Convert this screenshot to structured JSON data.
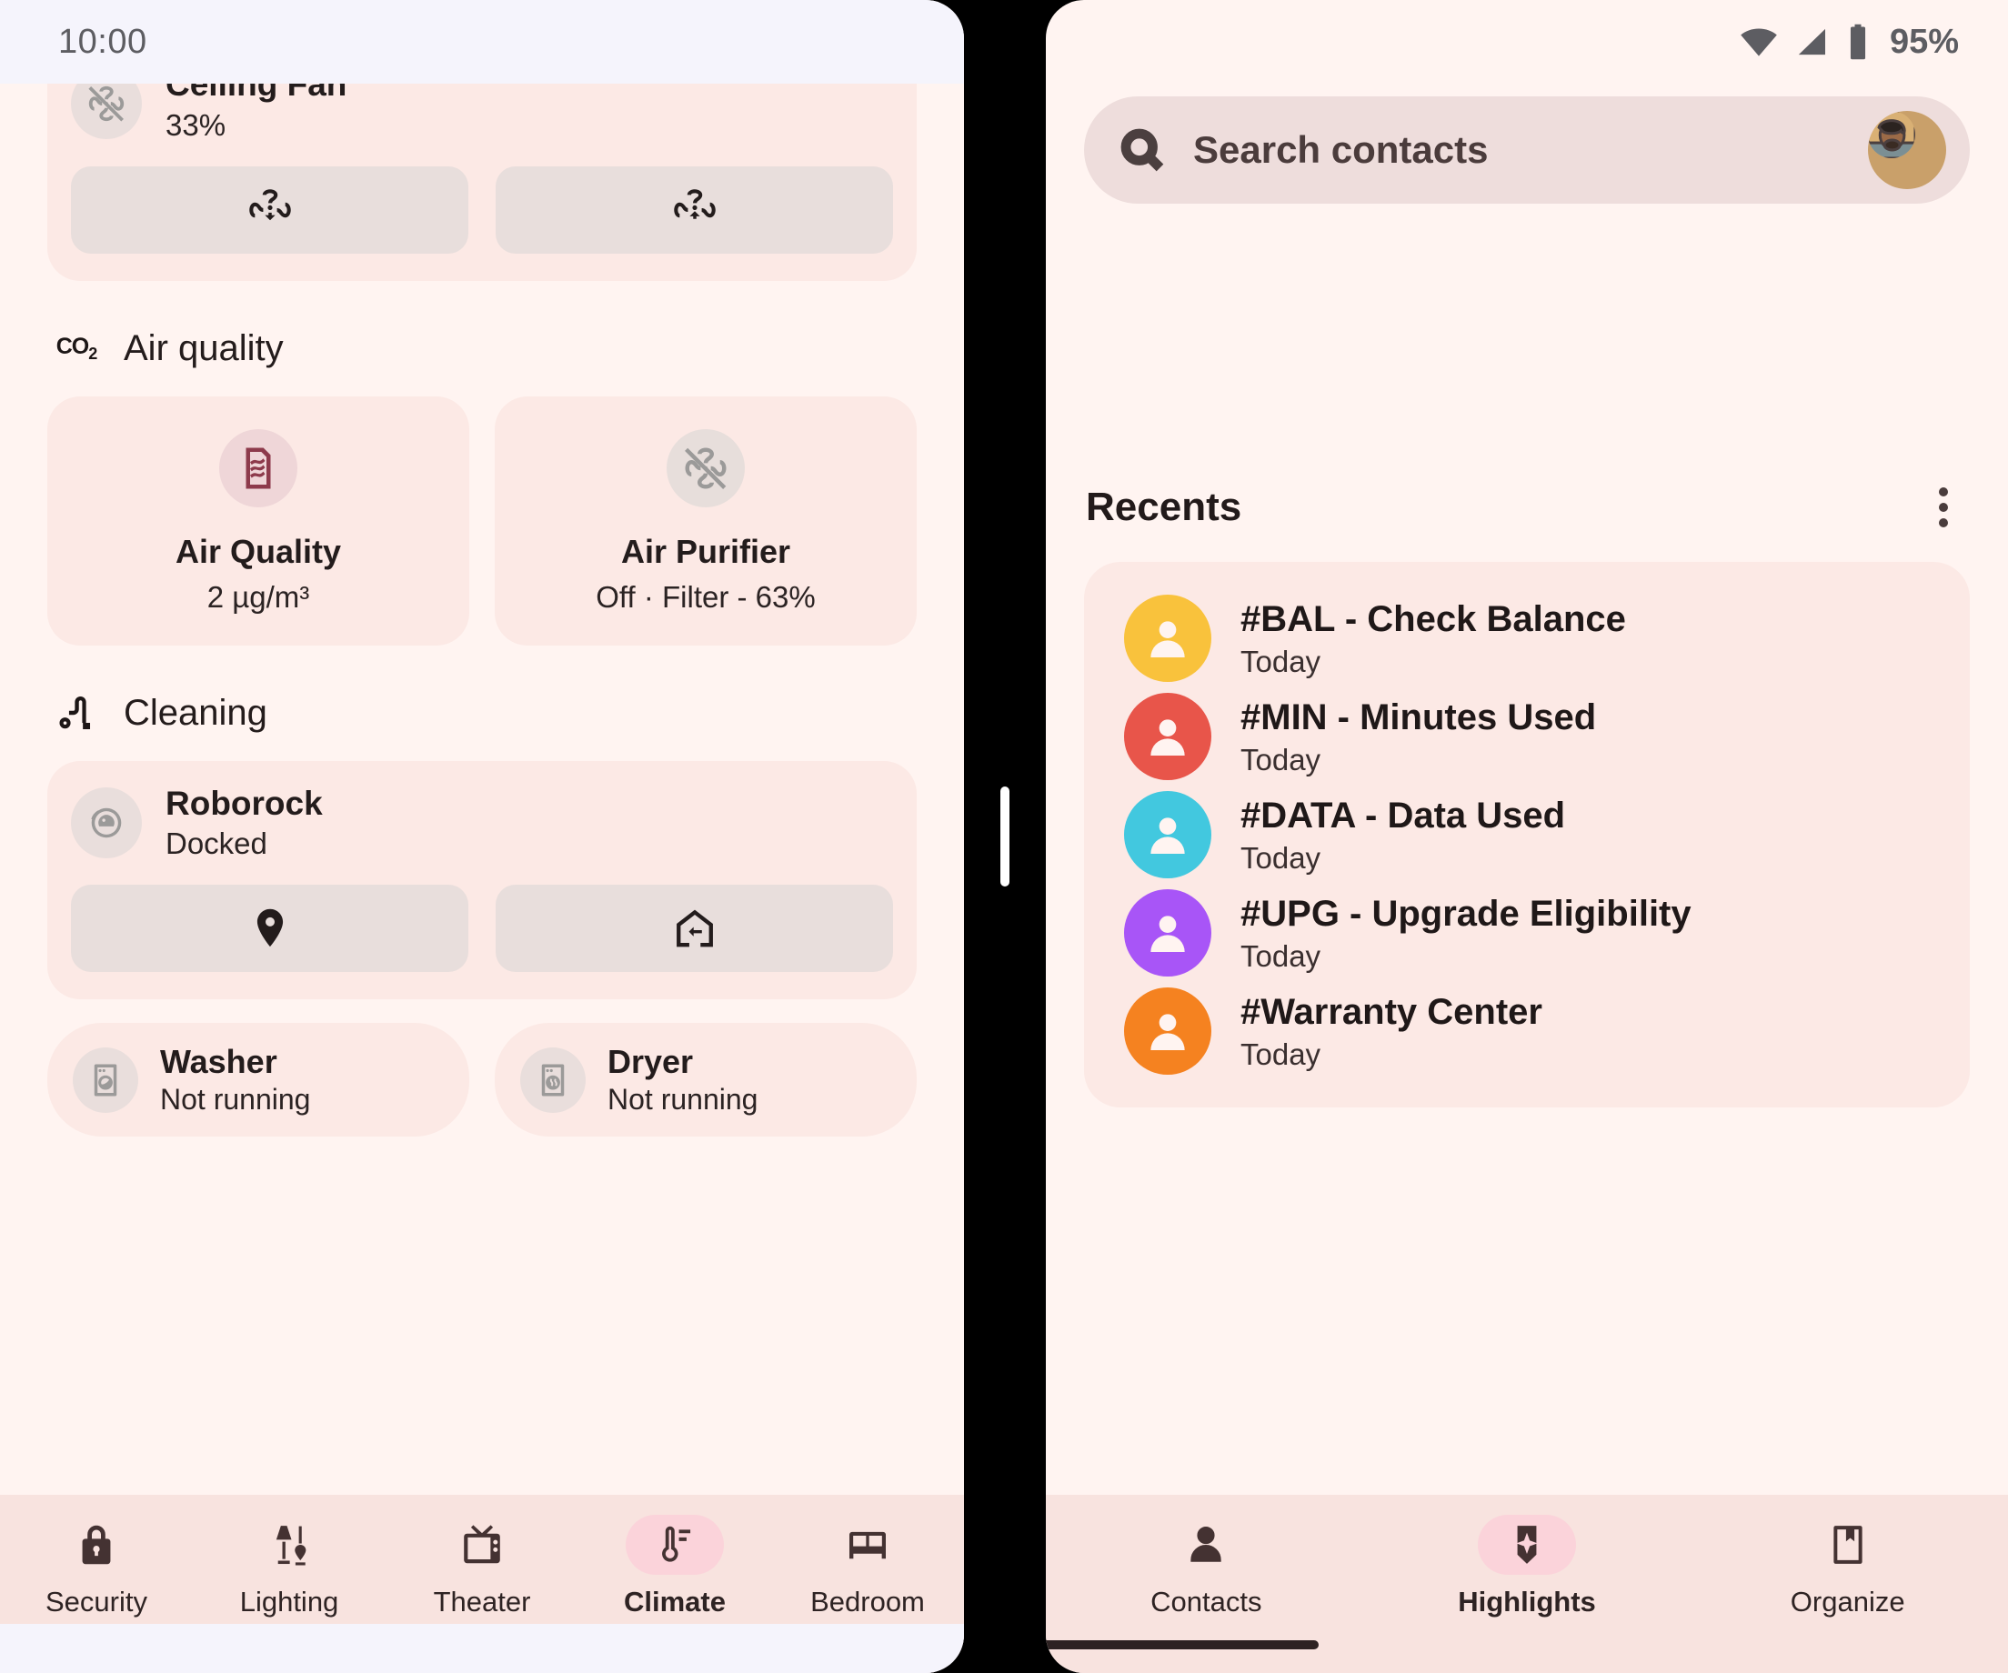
{
  "left_phone": {
    "status_bar": {
      "clock": "10:00"
    },
    "ceiling_fan_card": {
      "icon": "fan-off-icon",
      "name": "Ceiling Fan",
      "value": "33%",
      "buttons": [
        {
          "icon": "fan-speed-down-icon",
          "name": "fan-speed-down"
        },
        {
          "icon": "fan-speed-up-icon",
          "name": "fan-speed-up"
        }
      ]
    },
    "air_quality_section": {
      "icon": "co2-icon",
      "icon_text": "CO",
      "icon_sub": "2",
      "title": "Air quality",
      "tiles": [
        {
          "icon": "air-filter-icon",
          "name": "Air Quality",
          "sub": "2 µg/m³",
          "style": "accent"
        },
        {
          "icon": "fan-off-icon",
          "name": "Air Purifier",
          "sub": "Off · Filter - 63%",
          "style": "muted"
        }
      ]
    },
    "cleaning_section": {
      "icon": "vacuum-icon",
      "title": "Cleaning",
      "robot": {
        "icon": "robot-vacuum-icon",
        "name": "Roborock",
        "sub": "Docked",
        "buttons": [
          {
            "icon": "location-pin-icon",
            "name": "locate-robot"
          },
          {
            "icon": "return-to-dock-icon",
            "name": "return-to-dock"
          }
        ]
      },
      "appliances": [
        {
          "icon": "washer-icon",
          "name": "Washer",
          "sub": "Not running"
        },
        {
          "icon": "dryer-icon",
          "name": "Dryer",
          "sub": "Not running"
        }
      ]
    },
    "bottom_nav": {
      "items": [
        {
          "label": "Security",
          "icon": "lock-icon",
          "active": false
        },
        {
          "label": "Lighting",
          "icon": "lamp-icon",
          "active": false
        },
        {
          "label": "Theater",
          "icon": "tv-icon",
          "active": false
        },
        {
          "label": "Climate",
          "icon": "thermostat-icon",
          "active": true
        },
        {
          "label": "Bedroom",
          "icon": "bed-icon",
          "active": false
        }
      ]
    }
  },
  "right_phone": {
    "status_bar": {
      "wifi_icon": "wifi-icon",
      "signal_icon": "cellular-signal-icon",
      "battery_icon": "battery-icon",
      "battery_percent": "95%"
    },
    "search": {
      "icon": "search-icon",
      "placeholder": "Search contacts",
      "avatar": "user-avatar"
    },
    "recents": {
      "title": "Recents",
      "menu_icon": "more-vertical-icon",
      "items": [
        {
          "name": "#BAL - Check Balance",
          "time": "Today",
          "color": "#F9C23C"
        },
        {
          "name": "#MIN - Minutes Used",
          "time": "Today",
          "color": "#E8554A"
        },
        {
          "name": "#DATA - Data Used",
          "time": "Today",
          "color": "#42C8DF"
        },
        {
          "name": "#UPG - Upgrade Eligibility",
          "time": "Today",
          "color": "#A855F7"
        },
        {
          "name": "#Warranty Center",
          "time": "Today",
          "color": "#F58220"
        }
      ]
    },
    "bottom_nav": {
      "items": [
        {
          "label": "Contacts",
          "icon": "person-icon",
          "active": false
        },
        {
          "label": "Highlights",
          "icon": "sparkle-icon",
          "active": true
        },
        {
          "label": "Organize",
          "icon": "bookmark-icon",
          "active": false
        }
      ]
    }
  },
  "colors": {
    "background": "#FFF4F1",
    "card": "#FCE9E5",
    "nav_bar": "#F8E3DF",
    "accent_pill": "#FBD3DA",
    "status_bar_left": "#F5F4FC",
    "text_primary": "#231c1c"
  }
}
